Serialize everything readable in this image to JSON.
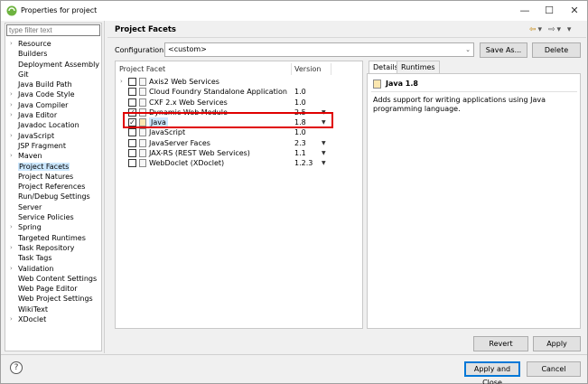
{
  "window": {
    "title": "Properties for project",
    "minimize": "—",
    "maximize": "☐",
    "close": "✕"
  },
  "left": {
    "filter_placeholder": "type filter text",
    "items": [
      {
        "label": "Resource",
        "expandable": true,
        "selected": false
      },
      {
        "label": "Builders",
        "expandable": false,
        "selected": false
      },
      {
        "label": "Deployment Assembly",
        "expandable": false,
        "selected": false
      },
      {
        "label": "Git",
        "expandable": false,
        "selected": false
      },
      {
        "label": "Java Build Path",
        "expandable": false,
        "selected": false
      },
      {
        "label": "Java Code Style",
        "expandable": true,
        "selected": false
      },
      {
        "label": "Java Compiler",
        "expandable": true,
        "selected": false
      },
      {
        "label": "Java Editor",
        "expandable": true,
        "selected": false
      },
      {
        "label": "Javadoc Location",
        "expandable": false,
        "selected": false
      },
      {
        "label": "JavaScript",
        "expandable": true,
        "selected": false
      },
      {
        "label": "JSP Fragment",
        "expandable": false,
        "selected": false
      },
      {
        "label": "Maven",
        "expandable": true,
        "selected": false
      },
      {
        "label": "Project Facets",
        "expandable": false,
        "selected": true
      },
      {
        "label": "Project Natures",
        "expandable": false,
        "selected": false
      },
      {
        "label": "Project References",
        "expandable": false,
        "selected": false
      },
      {
        "label": "Run/Debug Settings",
        "expandable": false,
        "selected": false
      },
      {
        "label": "Server",
        "expandable": false,
        "selected": false
      },
      {
        "label": "Service Policies",
        "expandable": false,
        "selected": false
      },
      {
        "label": "Spring",
        "expandable": true,
        "selected": false
      },
      {
        "label": "Targeted Runtimes",
        "expandable": false,
        "selected": false
      },
      {
        "label": "Task Repository",
        "expandable": true,
        "selected": false
      },
      {
        "label": "Task Tags",
        "expandable": false,
        "selected": false
      },
      {
        "label": "Validation",
        "expandable": true,
        "selected": false
      },
      {
        "label": "Web Content Settings",
        "expandable": false,
        "selected": false
      },
      {
        "label": "Web Page Editor",
        "expandable": false,
        "selected": false
      },
      {
        "label": "Web Project Settings",
        "expandable": false,
        "selected": false
      },
      {
        "label": "WikiText",
        "expandable": false,
        "selected": false
      },
      {
        "label": "XDoclet",
        "expandable": true,
        "selected": false
      }
    ]
  },
  "right": {
    "title": "Project Facets",
    "configuration_label": "Configuration:",
    "configuration_value": "<custom>",
    "save_as": "Save As...",
    "delete": "Delete",
    "col_facet": "Project Facet",
    "col_version": "Version",
    "facets": [
      {
        "name": "Axis2 Web Services",
        "version": "",
        "checked": false,
        "expandable": true,
        "dropdown": false,
        "selected": false
      },
      {
        "name": "Cloud Foundry Standalone Application",
        "version": "1.0",
        "checked": false,
        "expandable": false,
        "dropdown": false,
        "selected": false
      },
      {
        "name": "CXF 2.x Web Services",
        "version": "1.0",
        "checked": false,
        "expandable": false,
        "dropdown": false,
        "selected": false
      },
      {
        "name": "Dynamic Web Module",
        "version": "2.5",
        "checked": true,
        "expandable": false,
        "dropdown": true,
        "selected": false
      },
      {
        "name": "Java",
        "version": "1.8",
        "checked": true,
        "expandable": false,
        "dropdown": true,
        "selected": true
      },
      {
        "name": "JavaScript",
        "version": "1.0",
        "checked": false,
        "expandable": false,
        "dropdown": false,
        "selected": false
      },
      {
        "name": "JavaServer Faces",
        "version": "2.3",
        "checked": false,
        "expandable": false,
        "dropdown": true,
        "selected": false
      },
      {
        "name": "JAX-RS (REST Web Services)",
        "version": "1.1",
        "checked": false,
        "expandable": false,
        "dropdown": true,
        "selected": false
      },
      {
        "name": "WebDoclet (XDoclet)",
        "version": "1.2.3",
        "checked": false,
        "expandable": false,
        "dropdown": true,
        "selected": false
      }
    ],
    "tab_details": "Details",
    "tab_runtimes": "Runtimes",
    "detail_title": "Java 1.8",
    "detail_desc": "Adds support for writing applications using Java programming language.",
    "revert": "Revert",
    "apply": "Apply"
  },
  "footer": {
    "help": "?",
    "apply_close": "Apply and Close",
    "cancel": "Cancel"
  },
  "colors": {
    "highlight_box": "#e00000",
    "selection": "#cce8ff",
    "default_button_border": "#0078d7"
  }
}
